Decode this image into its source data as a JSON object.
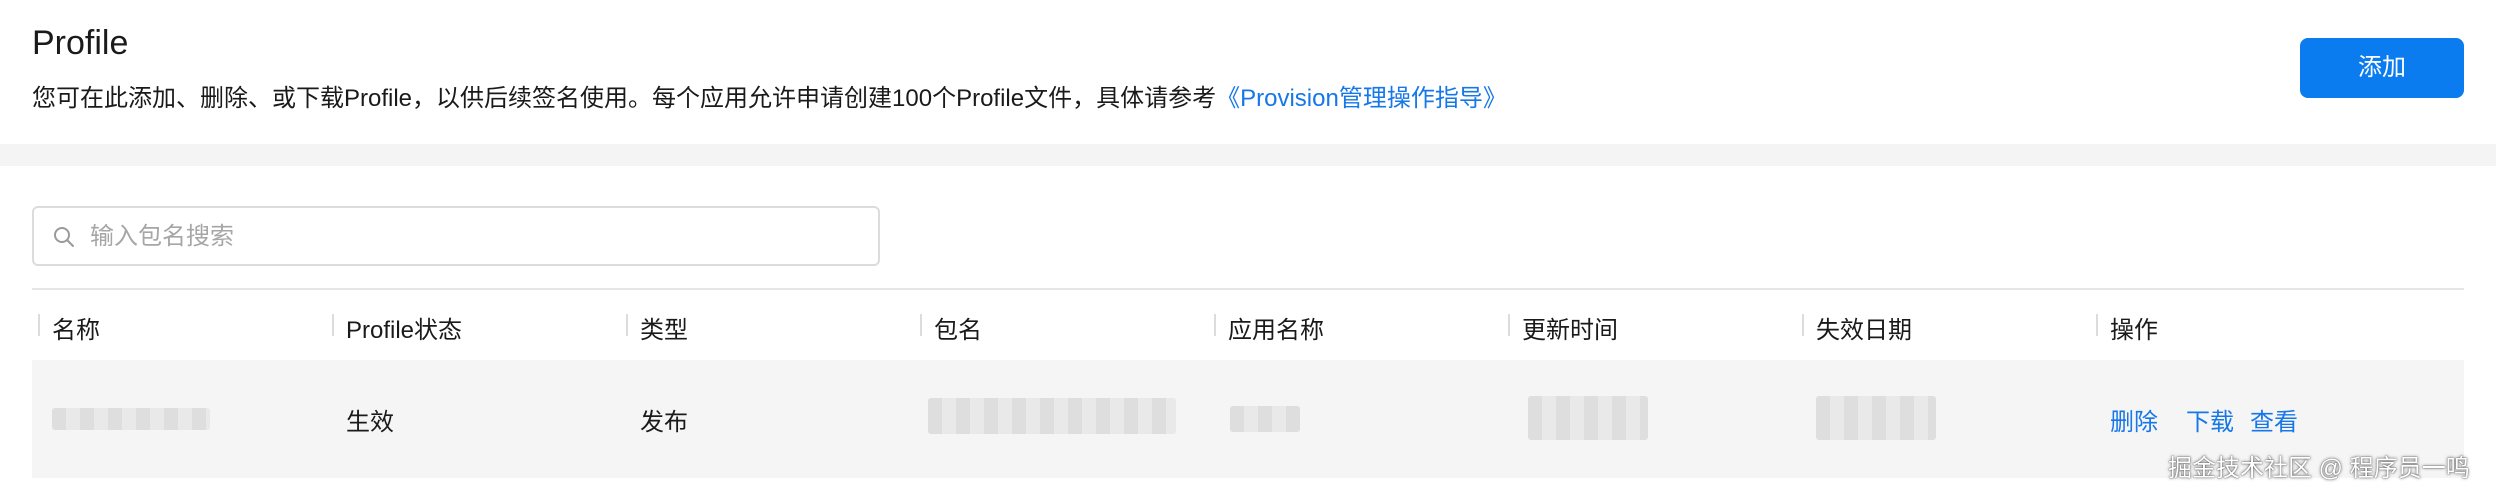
{
  "header": {
    "title": "Profile",
    "description": "您可在此添加、删除、或下载Profile，以供后续签名使用。每个应用允许申请创建100个Profile文件，具体请参考",
    "doc_link": "《Provision管理操作指导》",
    "add_button": "添加"
  },
  "search": {
    "placeholder": "输入包名搜索",
    "icon": "search-icon"
  },
  "table": {
    "columns": [
      "名称",
      "Profile状态",
      "类型",
      "包名",
      "应用名称",
      "更新时间",
      "失效日期",
      "操作"
    ],
    "rows": [
      {
        "name": "",
        "status": "生效",
        "type": "发布",
        "package": "",
        "app_name": "",
        "updated": "",
        "expires": "",
        "actions": [
          "删除",
          "下载",
          "查看"
        ]
      }
    ]
  },
  "watermark": "掘金技术社区 @ 程序员一鸣",
  "colors": {
    "accent": "#0a7cf0",
    "link": "#1677e8",
    "row_bg": "#f5f5f5"
  }
}
